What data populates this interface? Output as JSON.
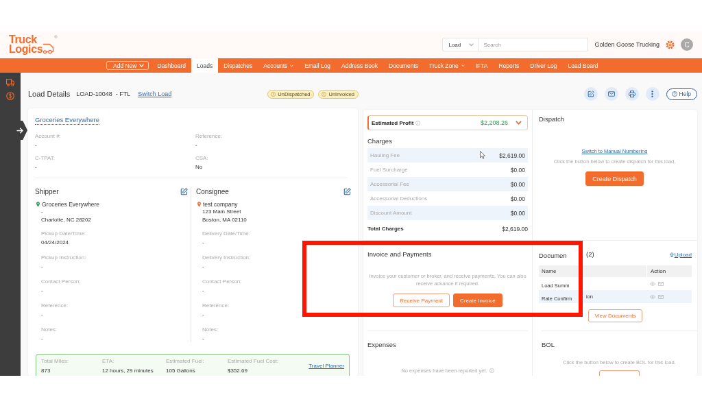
{
  "header": {
    "logo": {
      "lines": [
        "Truck",
        "Logics"
      ],
      "mark": "®"
    },
    "search": {
      "scope": "Load",
      "placeholder": "Search"
    },
    "company": "Golden Goose Trucking",
    "avatar": "C"
  },
  "nav": {
    "add_button": "Add New",
    "items": [
      {
        "label": "Dashboard",
        "selected": false,
        "dropdown": false
      },
      {
        "label": "Loads",
        "selected": true,
        "dropdown": false
      },
      {
        "label": "Dispatches",
        "selected": false,
        "dropdown": false
      },
      {
        "label": "Accounts",
        "selected": false,
        "dropdown": true
      },
      {
        "label": "Email Log",
        "selected": false,
        "dropdown": false
      },
      {
        "label": "Address Book",
        "selected": false,
        "dropdown": false
      },
      {
        "label": "Documents",
        "selected": false,
        "dropdown": false
      },
      {
        "label": "Truck Zone",
        "selected": false,
        "dropdown": true
      },
      {
        "label": "IFTA",
        "selected": false,
        "dropdown": false
      },
      {
        "label": "Reports",
        "selected": false,
        "dropdown": false
      },
      {
        "label": "Driver Log",
        "selected": false,
        "dropdown": false
      },
      {
        "label": "Load Board",
        "selected": false,
        "dropdown": false
      }
    ]
  },
  "page": {
    "title": "Load Details",
    "load_number": "LOAD-10048",
    "load_type": "- FTL",
    "switch_link": "Switch Load",
    "badges": [
      "UnDispatched",
      "UnInvoiced"
    ],
    "help": "Help"
  },
  "customer": {
    "name": "Groceries Everywhere",
    "fields": [
      {
        "label": "Account #:",
        "value": "-"
      },
      {
        "label": "Reference:",
        "value": "-"
      },
      {
        "label": "C-TPAT:",
        "value": "-"
      },
      {
        "label": "CSA:",
        "value": "No"
      }
    ]
  },
  "stops": [
    {
      "heading": "Shipper",
      "color": "#2e9a57",
      "name": "Groceries Everywhere",
      "address": [
        "-",
        "Charlotte, NC 28202"
      ],
      "fields": [
        {
          "label": "Pickup Date/Time:",
          "value": "04/24/2024"
        },
        {
          "label": "Pickup Instruction:",
          "value": "-"
        },
        {
          "label": "Contact Person:",
          "value": "-"
        },
        {
          "label": "Reference:",
          "value": "-"
        },
        {
          "label": "Notes:",
          "value": "-"
        }
      ]
    },
    {
      "heading": "Consignee",
      "color": "#f26d2d",
      "name": "test company",
      "address": [
        "123 Main Street",
        "Boston, MA 02110"
      ],
      "fields": [
        {
          "label": "Delivery Date/Time:",
          "value": "-"
        },
        {
          "label": "Delivery Instruction:",
          "value": "-"
        },
        {
          "label": "Contact Person:",
          "value": "-"
        },
        {
          "label": "Reference:",
          "value": "-"
        },
        {
          "label": "Notes:",
          "value": "-"
        }
      ]
    }
  ],
  "trip": {
    "fields": [
      {
        "label": "Total Miles:",
        "value": "873"
      },
      {
        "label": "ETA:",
        "value": "12 hours, 29 minutes"
      },
      {
        "label": "Estimated Fuel:",
        "value": "105 Gallons"
      },
      {
        "label": "Estimated Fuel Cost:",
        "value": "$352.69"
      }
    ],
    "link": "Travel Planner"
  },
  "profit": {
    "label": "Estimated Profit",
    "value": "$2,208.26",
    "expanded": false
  },
  "charges": {
    "title": "Charges",
    "rows": [
      {
        "label": "Hauling Fee",
        "amount": "$2,619.00"
      },
      {
        "label": "Fuel Surcharge",
        "amount": "$0.00"
      },
      {
        "label": "Accessorial Fee",
        "amount": "$0.00"
      },
      {
        "label": "Accessorial Deductions",
        "amount": "$0.00"
      },
      {
        "label": "Discount Amount",
        "amount": "$0.00"
      }
    ],
    "total": {
      "label": "Total Charges",
      "amount": "$2,619.00"
    }
  },
  "invoice": {
    "title": "Invoice and Payments",
    "text": "Invoice your customer or broker, and receive payments. You can also receive advance if required.",
    "buttons": [
      {
        "label": "Receive Payment",
        "kind": "outline"
      },
      {
        "label": "Create Invoice",
        "kind": "primary"
      }
    ]
  },
  "expenses": {
    "title": "Expenses",
    "text": "No expenses have been reported yet."
  },
  "dispatch": {
    "title": "Dispatch",
    "link": "Switch to Manual Numbering",
    "text": "Click the button below to create dispatch for this load.",
    "button": "Create Dispatch"
  },
  "documents": {
    "title_parts": [
      "Documen",
      "(2)"
    ],
    "upload": "Upload",
    "columns": [
      "Name",
      "Action"
    ],
    "rows": [
      {
        "name_parts": [
          "Load Summ"
        ]
      },
      {
        "name_parts": [
          "Rate Confirm",
          "ion"
        ]
      }
    ],
    "button": "View Documents"
  },
  "bol": {
    "title": "BOL",
    "text": "Click the button below to create BOL for this load."
  }
}
